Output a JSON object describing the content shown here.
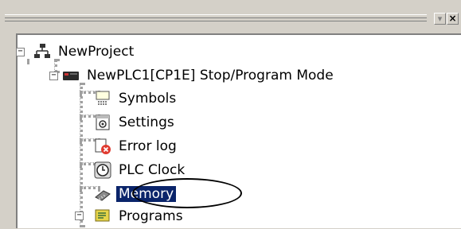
{
  "window": {
    "dropdown_glyph": "▾",
    "close_glyph": "×"
  },
  "tree": {
    "root": {
      "label": "NewProject",
      "expander": "−"
    },
    "plc": {
      "label": "NewPLC1[CP1E] Stop/Program Mode",
      "expander": "−"
    },
    "children": [
      {
        "label": "Symbols",
        "icon": "symbols-icon"
      },
      {
        "label": "Settings",
        "icon": "settings-icon"
      },
      {
        "label": "Error log",
        "icon": "error-log-icon"
      },
      {
        "label": "PLC Clock",
        "icon": "clock-icon"
      },
      {
        "label": "Memory",
        "icon": "memory-icon",
        "selected": true
      }
    ],
    "programs": {
      "label": "Programs",
      "expander": "−",
      "icon": "programs-icon"
    }
  },
  "colors": {
    "selection": "#0a246a",
    "highlight_ring": "#000000"
  }
}
